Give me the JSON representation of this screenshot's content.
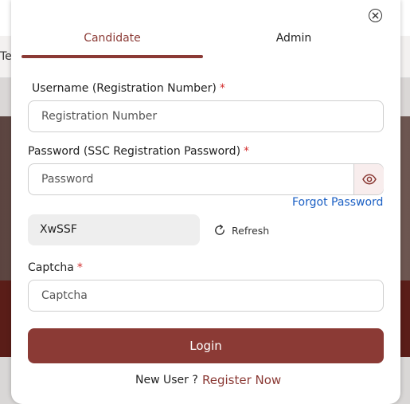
{
  "background": {
    "nav_text": "Te"
  },
  "modal": {
    "close_icon": "close-icon",
    "tabs": [
      {
        "label": "Candidate",
        "active": true
      },
      {
        "label": "Admin",
        "active": false
      }
    ],
    "username": {
      "label": "Username (Registration Number)",
      "required_mark": "*",
      "placeholder": "Registration Number",
      "value": ""
    },
    "password": {
      "label": "Password (SSC Registration Password)",
      "required_mark": "*",
      "placeholder": "Password",
      "value": "",
      "toggle_icon": "eye-icon"
    },
    "forgot_password": "Forgot Password",
    "captcha_code": "XwSSF",
    "refresh": {
      "icon": "refresh-icon",
      "label": "Refresh"
    },
    "captcha": {
      "label": "Captcha",
      "required_mark": "*",
      "placeholder": "Captcha",
      "value": ""
    },
    "login_label": "Login",
    "new_user_text": "New User ?",
    "register_label": "Register Now"
  },
  "colors": {
    "accent": "#8b3a35",
    "link": "#1a5fc4",
    "required": "#d32f2f"
  }
}
